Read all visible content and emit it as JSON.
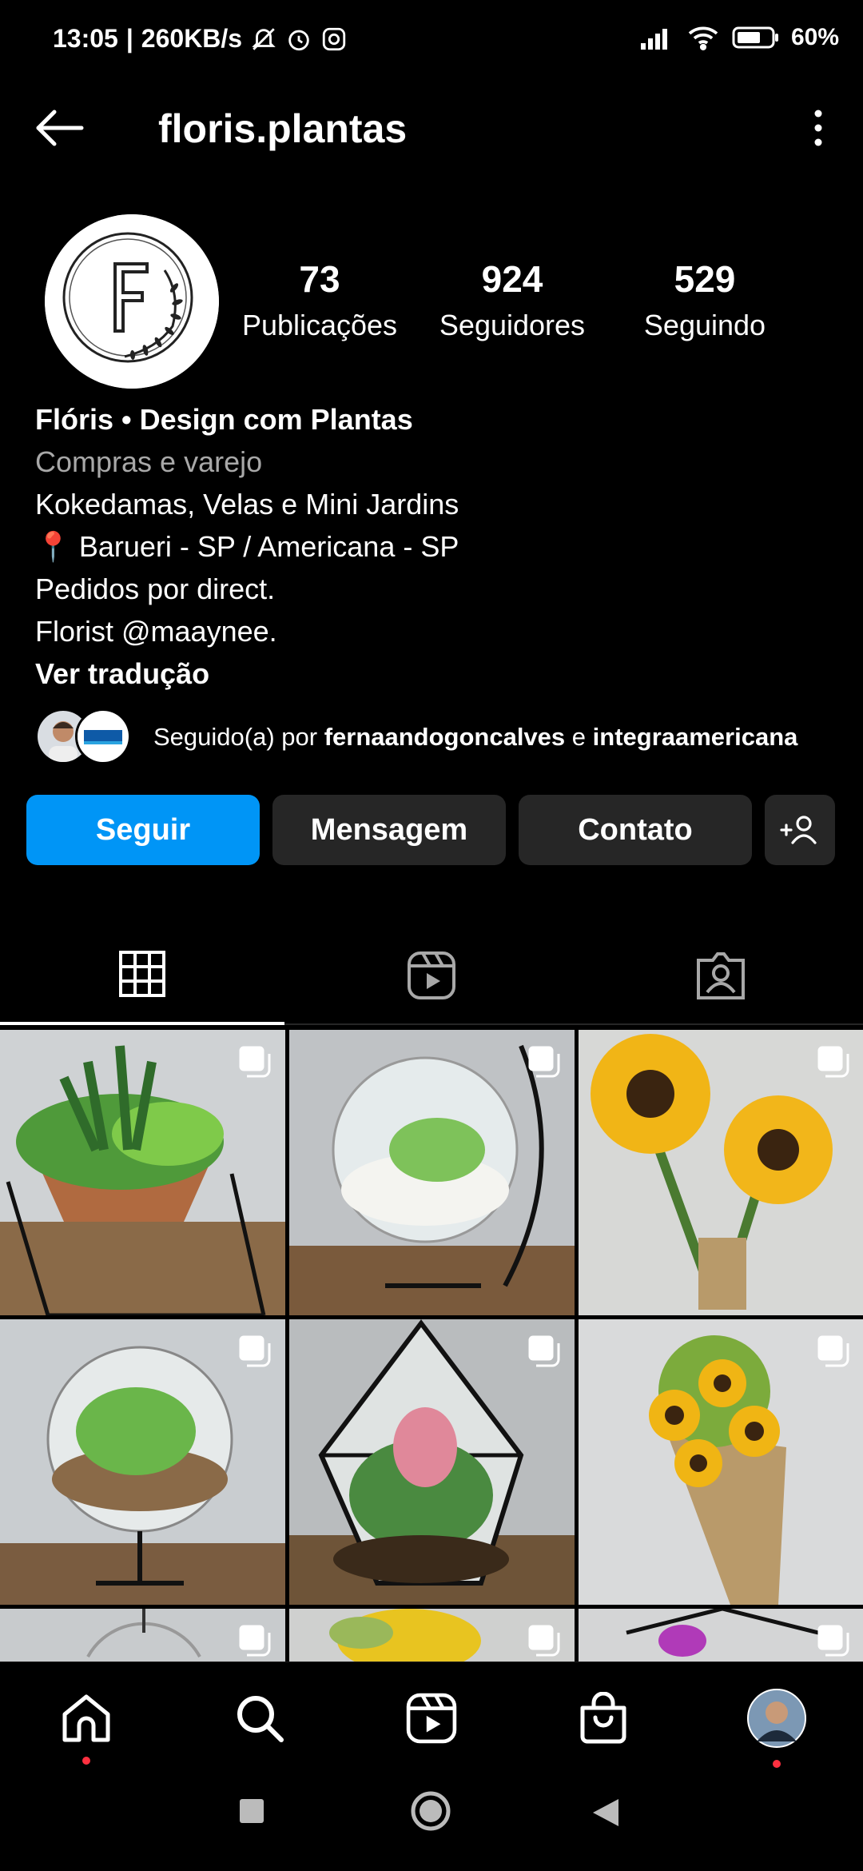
{
  "status_bar": {
    "time": "13:05",
    "speed": "260KB/s",
    "battery": "60%"
  },
  "header": {
    "username": "floris.plantas"
  },
  "profile": {
    "stats": [
      {
        "value": "73",
        "label": "Publicações"
      },
      {
        "value": "924",
        "label": "Seguidores"
      },
      {
        "value": "529",
        "label": "Seguindo"
      }
    ],
    "name": "Flóris • Design com Plantas",
    "category": "Compras e varejo",
    "bio_lines": [
      "Kokedamas, Velas e Mini Jardins",
      "📍 Barueri - SP / Americana - SP",
      "Pedidos por direct.",
      "Florist @maaynee."
    ],
    "translate": "Ver tradução",
    "followed_by": {
      "prefix": "Seguido(a) por ",
      "user1": "fernaandogoncalves",
      "joiner": " e ",
      "user2": "integraamericana"
    }
  },
  "actions": {
    "follow": "Seguir",
    "message": "Mensagem",
    "contact": "Contato"
  },
  "colors": {
    "accent": "#0095f6",
    "button_bg": "#262626",
    "secondary_text": "#a8a8a8"
  }
}
